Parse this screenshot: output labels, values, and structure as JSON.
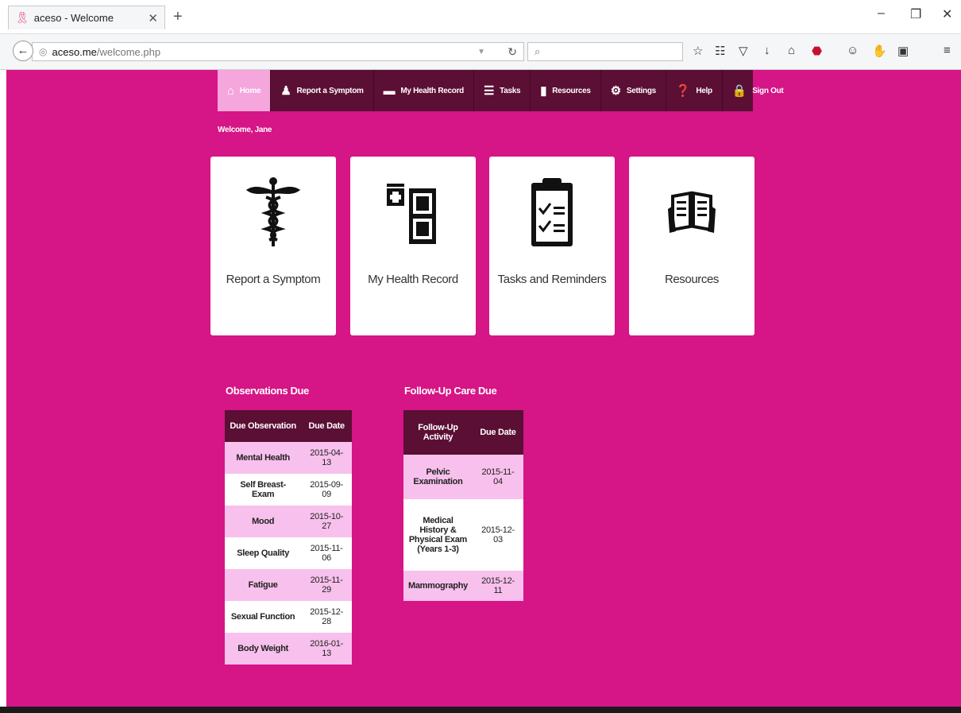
{
  "browser": {
    "tab_title": "aceso - Welcome",
    "url_host": "aceso.me",
    "url_path": "/welcome.php"
  },
  "nav": {
    "home": "Home",
    "report": "Report a Symptom",
    "record": "My Health Record",
    "tasks": "Tasks",
    "resources": "Resources",
    "settings": "Settings",
    "help": "Help",
    "signout": "Sign Out"
  },
  "welcome": "Welcome, Jane",
  "cards": {
    "report": "Report a Symptom",
    "record": "My Health Record",
    "tasks": "Tasks and Reminders",
    "resources": "Resources"
  },
  "observations": {
    "title": "Observations Due",
    "col1": "Due Observation",
    "col2": "Due Date",
    "rows": [
      {
        "name": "Mental Health",
        "date": "2015-04-13"
      },
      {
        "name": "Self Breast-Exam",
        "date": "2015-09-09"
      },
      {
        "name": "Mood",
        "date": "2015-10-27"
      },
      {
        "name": "Sleep Quality",
        "date": "2015-11-06"
      },
      {
        "name": "Fatigue",
        "date": "2015-11-29"
      },
      {
        "name": "Sexual Function",
        "date": "2015-12-28"
      },
      {
        "name": "Body Weight",
        "date": "2016-01-13"
      }
    ]
  },
  "followup": {
    "title": "Follow-Up Care Due",
    "col1": "Follow-Up Activity",
    "col2": "Due Date",
    "rows": [
      {
        "name": "Pelvic Examination",
        "date": "2015-11-04"
      },
      {
        "name": "Medical History & Physical Exam (Years 1-3)",
        "date": "2015-12-03"
      },
      {
        "name": "Mammography",
        "date": "2015-12-11"
      }
    ]
  }
}
